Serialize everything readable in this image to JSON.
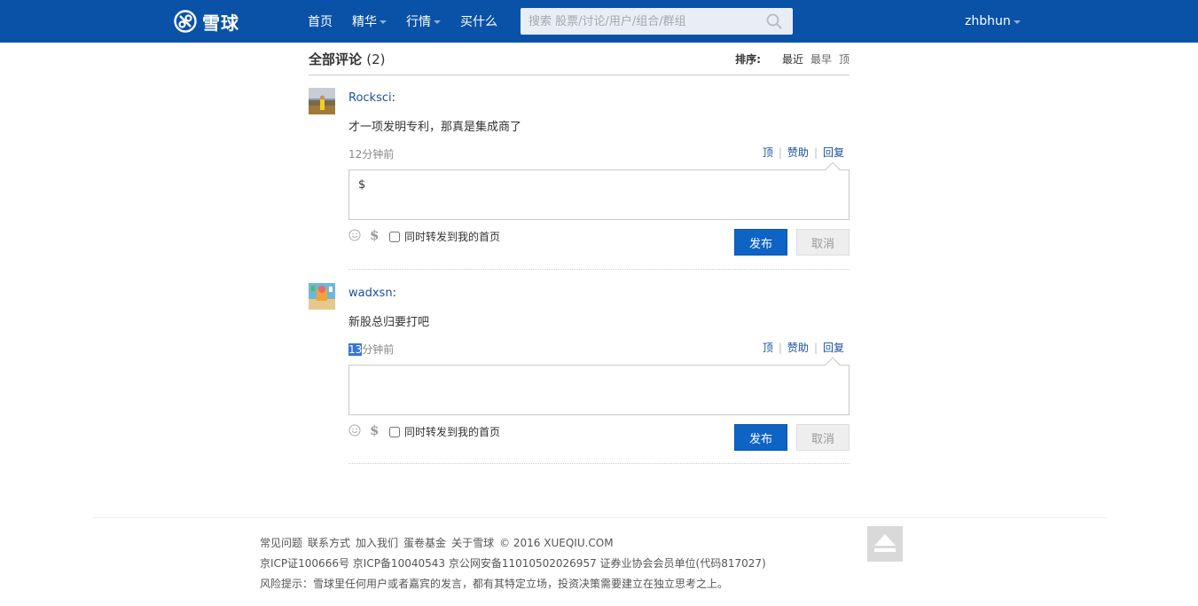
{
  "header": {
    "logo_text": "雪球",
    "nav": [
      "首页",
      "精华",
      "行情",
      "买什么"
    ],
    "search_placeholder": "搜索 股票/讨论/用户/组合/群组",
    "username": "zhbhun"
  },
  "comments": {
    "title": "全部评论",
    "count": "(2)",
    "sort_label": "排序:",
    "sort_options": [
      "最近",
      "最早",
      "顶"
    ],
    "items": [
      {
        "author": "Rocksci",
        "colon": ":",
        "text": "才一项发明专利，那真是集成商了",
        "time_hl": "",
        "time": "12分钟前",
        "actions": [
          "顶",
          "赞助",
          "回复"
        ],
        "reply_value": "$",
        "forward_label": "同时转发到我的首页",
        "publish": "发布",
        "cancel": "取消",
        "dollar_icon": "$"
      },
      {
        "author": "wadxsn",
        "colon": ":",
        "text": "新股总归要打吧",
        "time_hl": "13",
        "time": "分钟前",
        "actions": [
          "顶",
          "赞助",
          "回复"
        ],
        "reply_value": "",
        "forward_label": "同时转发到我的首页",
        "publish": "发布",
        "cancel": "取消",
        "dollar_icon": "$"
      }
    ]
  },
  "footer": {
    "links": [
      "常见问题",
      "联系方式",
      "加入我们",
      "蛋卷基金",
      "关于雪球"
    ],
    "copyright": "© 2016 XUEQIU.COM",
    "line2": "京ICP证100666号 京ICP备10040543 京公网安备11010502026957 证券业协会会员单位(代码817027)",
    "line3": "风险提示：雪球里任何用户或者嘉宾的发言，都有其特定立场，投资决策需要建立在独立思考之上。"
  },
  "icons": {
    "logo": "xueqiu-logo-icon",
    "search": "search-icon",
    "emoji": "emoji-icon",
    "dollar": "dollar-icon",
    "back_to_top": "back-to-top-icon"
  },
  "colors": {
    "header_bg": "#0952a8",
    "link": "#1a4f9c",
    "primary_button": "#0e64c4"
  }
}
